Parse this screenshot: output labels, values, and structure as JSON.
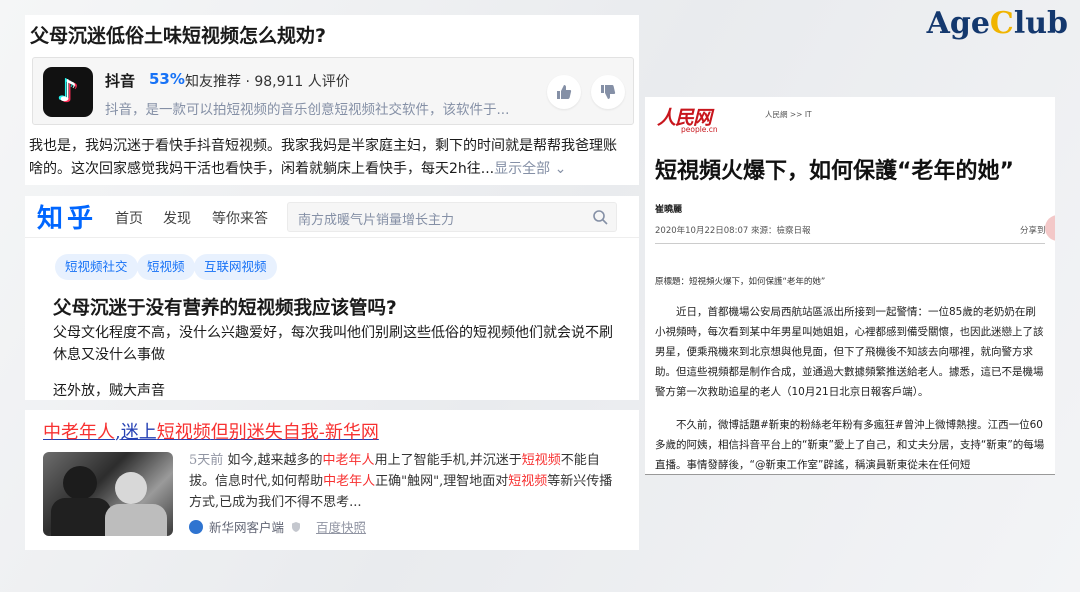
{
  "brand": {
    "logo_main": "Age",
    "logo_c": "C",
    "logo_rest": "lub"
  },
  "zhihu_question": {
    "title": "父母沉迷低俗土味短视频怎么规劝?",
    "app": {
      "name": "抖音",
      "percent": "53%",
      "recommend": "知友推荐 · 98,911 人评价",
      "desc": "抖音，是一款可以拍短视频的音乐创意短视频社交软件，该软件于...",
      "icon": "tiktok-icon"
    },
    "answer": "我也是，我妈沉迷于看快手抖音短视频。我家我妈是半家庭主妇，剩下的时间就是帮帮我爸理账啥的。这次回家感觉我妈干活也看快手，闲着就躺床上看快手，每天2h往...",
    "more": "显示全部"
  },
  "zhihu_page": {
    "logo": "知乎",
    "nav": [
      "首页",
      "发现",
      "等你来答"
    ],
    "search_placeholder": "南方成暖气片销量增长主力",
    "tags": [
      "短视频社交",
      "短视频",
      "互联网视频"
    ],
    "question": "父母沉迷于没有营养的短视频我应该管吗?",
    "body": "父母文化程度不高，没什么兴趣爱好，每次我叫他们别刷这些低俗的短视频他们就会说不刷休息又没什么事做",
    "extra": "还外放，贼大声音"
  },
  "baidu_result": {
    "title_parts": [
      "中老年人",
      ",",
      "迷上",
      "短视频",
      "但别迷失自我-新华网"
    ],
    "snippet_time": "5天前",
    "snippet_parts": [
      " 如今,越来越多的",
      "中老年人",
      "用上了智能手机,并沉迷于",
      "短视频",
      "不能自拔。信息时代,如何帮助",
      "中老年人",
      "正确\"触网\",理智地面对",
      "短视频",
      "等新兴传播方式,已成为我们不得不思考..."
    ],
    "source": "新华网客户端",
    "cache": "百度快照"
  },
  "people_article": {
    "logo_zh": "人民网",
    "logo_en": "people.cn",
    "crumb": "人民網 >> IT",
    "title": "短視頻火爆下，如何保護“老年的她”",
    "author": "崔曉麗",
    "meta": "2020年10月22日08:07  來源：檢察日報",
    "share": "分享到:",
    "orig_title": "原標題：短視頻火爆下，如何保護“老年的她”",
    "para1": "近日，首都機場公安局西航站區派出所接到一起警情：一位85歲的老奶奶在刷小視頻時，每次看到某中年男星叫她姐姐，心裡都感到備受關懷，也因此迷戀上了該男星，便乘飛機來到北京想與他見面，但下了飛機後不知該去向哪裡，就向警方求助。但這些視頻都是制作合成，並通過大數據頻繁推送給老人。據悉，這已不是機場警方第一次救助追星的老人（10月21日北京日報客戶端）。",
    "para2": "不久前，微博話題#靳東的粉絲老年粉有多瘋狂#曾沖上微博熱搜。江西一位60多歲的阿姨，相信抖音平台上的“靳東”愛上了自己，和丈夫分居，支持“靳東”的每場直播。事情發酵後，“@靳東工作室”辟謠，稱演員靳東從未在任何短"
  }
}
